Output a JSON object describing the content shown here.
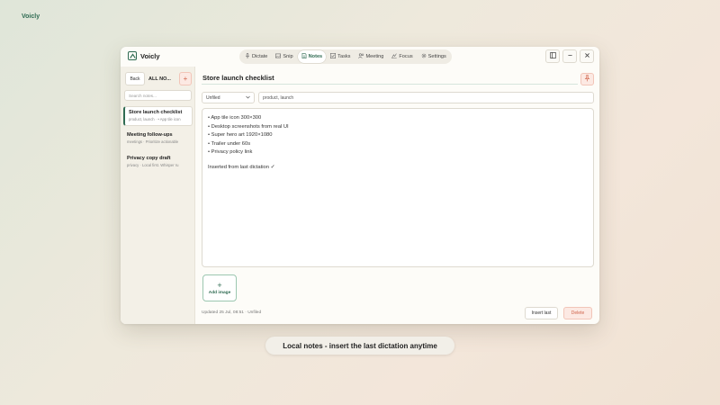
{
  "corner_brand": "Voicly",
  "app": {
    "name": "Voicly"
  },
  "nav": [
    {
      "label": "Dictate",
      "icon": "mic-icon"
    },
    {
      "label": "Snip",
      "icon": "image-icon"
    },
    {
      "label": "Notes",
      "icon": "note-icon",
      "active": true
    },
    {
      "label": "Tasks",
      "icon": "checkbox-icon"
    },
    {
      "label": "Meeting",
      "icon": "people-icon"
    },
    {
      "label": "Focus",
      "icon": "focus-icon"
    },
    {
      "label": "Settings",
      "icon": "gear-icon"
    }
  ],
  "sidebar": {
    "back_label": "Back",
    "filter_label": "ALL NO...",
    "add_label": "+",
    "search_placeholder": "Search notes...",
    "notes": [
      {
        "title": "Store launch checklist",
        "meta": "product, launch · • App tile icon",
        "active": true
      },
      {
        "title": "Meeting follow-ups",
        "meta": "meetings · Prioritize actionable"
      },
      {
        "title": "Privacy copy draft",
        "meta": "privacy · Local first. Whisper ru"
      }
    ]
  },
  "editor": {
    "title": "Store launch checklist",
    "folder": "Unfiled",
    "tags": "product, launch",
    "lines": [
      "• App tile icon 300×300",
      "• Desktop screenshots from real UI",
      "• Super hero art 1920×1080",
      "• Trailer under 60s",
      "• Privacy policy link"
    ],
    "appended": "Inserted from last dictation ✓",
    "add_image_label": "Add image",
    "status": "Updated 25 Jul, 08:51 · Unfiled",
    "insert_label": "Insert last",
    "delete_label": "Delete"
  },
  "caption": "Local notes - insert the last dictation anytime",
  "colors": {
    "accent": "#2f6b52",
    "danger": "#d0634a",
    "danger_bg": "#fce9e3"
  }
}
